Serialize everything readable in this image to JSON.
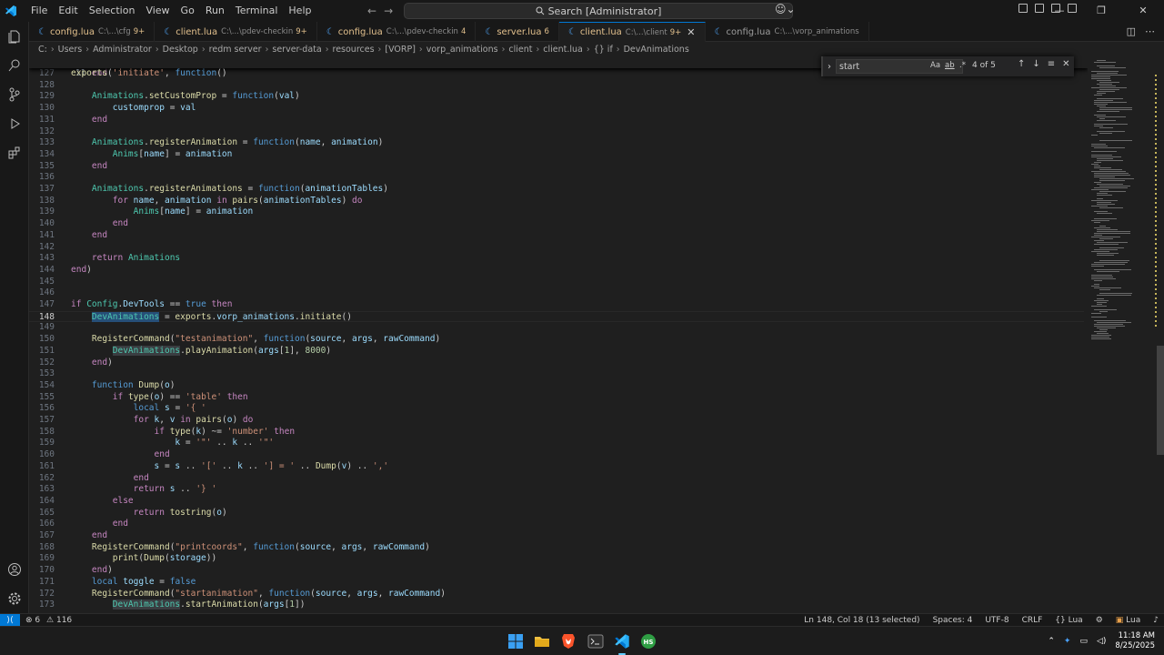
{
  "menu": [
    "File",
    "Edit",
    "Selection",
    "View",
    "Go",
    "Run",
    "Terminal",
    "Help"
  ],
  "title_search": "Search [Administrator]",
  "tabs": [
    {
      "name": "config.lua",
      "desc": "C:\\...\\cfg",
      "count": "9+"
    },
    {
      "name": "client.lua",
      "desc": "C:\\...\\pdev-checkin",
      "count": "9+"
    },
    {
      "name": "config.lua",
      "desc": "C:\\...\\pdev-checkin",
      "count": "4"
    },
    {
      "name": "server.lua",
      "desc": "",
      "count": "6"
    },
    {
      "name": "client.lua",
      "desc": "C:\\...\\client",
      "count": "9+"
    },
    {
      "name": "config.lua",
      "desc": "C:\\...\\vorp_animations",
      "count": ""
    }
  ],
  "breadcrumb": [
    "C:",
    "Users",
    "Administrator",
    "Desktop",
    "redm server",
    "server-data",
    "resources",
    "[VORP]",
    "vorp_animations",
    "client",
    "client.lua",
    "{} if",
    "DevAnimations"
  ],
  "find": {
    "value": "start",
    "opt_case": "Aa",
    "opt_word": "ab",
    "opt_regex": ".*",
    "count": "4 of 5"
  },
  "code": {
    "sticky": {
      "ln": "11",
      "text": "exports('initiate', function()"
    },
    "lines": [
      {
        "ln": "127",
        "t": "    end"
      },
      {
        "ln": "128",
        "t": ""
      },
      {
        "ln": "129",
        "t": "    Animations.setCustomProp = function(val)"
      },
      {
        "ln": "130",
        "t": "        customprop = val"
      },
      {
        "ln": "131",
        "t": "    end"
      },
      {
        "ln": "132",
        "t": ""
      },
      {
        "ln": "133",
        "t": "    Animations.registerAnimation = function(name, animation)"
      },
      {
        "ln": "134",
        "t": "        Anims[name] = animation"
      },
      {
        "ln": "135",
        "t": "    end"
      },
      {
        "ln": "136",
        "t": ""
      },
      {
        "ln": "137",
        "t": "    Animations.registerAnimations = function(animationTables)"
      },
      {
        "ln": "138",
        "t": "        for name, animation in pairs(animationTables) do"
      },
      {
        "ln": "139",
        "t": "            Anims[name] = animation"
      },
      {
        "ln": "140",
        "t": "        end"
      },
      {
        "ln": "141",
        "t": "    end"
      },
      {
        "ln": "142",
        "t": ""
      },
      {
        "ln": "143",
        "t": "    return Animations"
      },
      {
        "ln": "144",
        "t": "end)"
      },
      {
        "ln": "145",
        "t": ""
      },
      {
        "ln": "146",
        "t": ""
      },
      {
        "ln": "147",
        "t": "if Config.DevTools == true then"
      },
      {
        "ln": "148",
        "t": "    DevAnimations = exports.vorp_animations.initiate()"
      },
      {
        "ln": "149",
        "t": ""
      },
      {
        "ln": "150",
        "t": "    RegisterCommand(\"testanimation\", function(source, args, rawCommand)"
      },
      {
        "ln": "151",
        "t": "        DevAnimations.playAnimation(args[1], 8000)"
      },
      {
        "ln": "152",
        "t": "    end)"
      },
      {
        "ln": "153",
        "t": ""
      },
      {
        "ln": "154",
        "t": "    function Dump(o)"
      },
      {
        "ln": "155",
        "t": "        if type(o) == 'table' then"
      },
      {
        "ln": "156",
        "t": "            local s = '{ '"
      },
      {
        "ln": "157",
        "t": "            for k, v in pairs(o) do"
      },
      {
        "ln": "158",
        "t": "                if type(k) ~= 'number' then"
      },
      {
        "ln": "159",
        "t": "                    k = '\"' .. k .. '\"'"
      },
      {
        "ln": "160",
        "t": "                end"
      },
      {
        "ln": "161",
        "t": "                s = s .. '[' .. k .. '] = ' .. Dump(v) .. ','"
      },
      {
        "ln": "162",
        "t": "            end"
      },
      {
        "ln": "163",
        "t": "            return s .. '} '"
      },
      {
        "ln": "164",
        "t": "        else"
      },
      {
        "ln": "165",
        "t": "            return tostring(o)"
      },
      {
        "ln": "166",
        "t": "        end"
      },
      {
        "ln": "167",
        "t": "    end"
      },
      {
        "ln": "168",
        "t": "    RegisterCommand(\"printcoords\", function(source, args, rawCommand)"
      },
      {
        "ln": "169",
        "t": "        print(Dump(storage))"
      },
      {
        "ln": "170",
        "t": "    end)"
      },
      {
        "ln": "171",
        "t": "    local toggle = false"
      },
      {
        "ln": "172",
        "t": "    RegisterCommand(\"startanimation\", function(source, args, rawCommand)"
      },
      {
        "ln": "173",
        "t": "        DevAnimations.startAnimation(args[1])"
      }
    ],
    "current_line": "148"
  },
  "status": {
    "errors": "6",
    "warnings": "116",
    "position": "Ln 148, Col 18 (13 selected)",
    "spaces": "Spaces: 4",
    "encoding": "UTF-8",
    "eol": "CRLF",
    "language": "Lua",
    "lang2": "Lua"
  },
  "clock": {
    "time": "11:18 AM",
    "date": "8/25/2025"
  },
  "colors": {
    "accent": "#0078d4",
    "find_match": "#264f78"
  }
}
